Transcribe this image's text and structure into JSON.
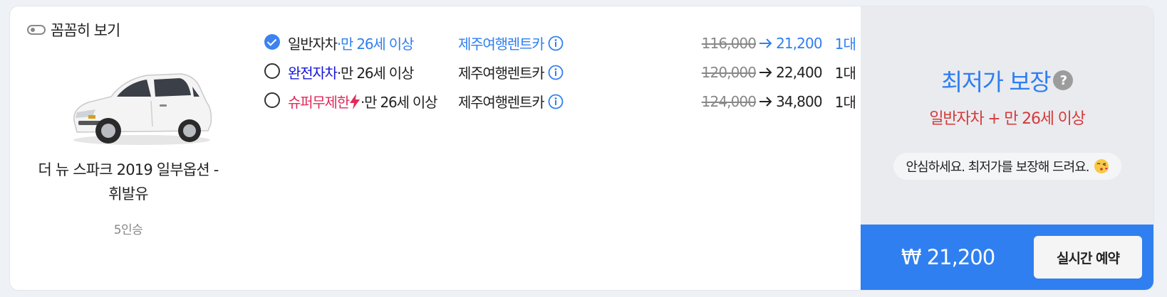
{
  "toggle": {
    "label": "꼼꼼히 보기"
  },
  "car": {
    "name": "더 뉴 스파크 2019 일부옵션 - 휘발유",
    "seats": "5인승",
    "image_icon": "car-image"
  },
  "options": [
    {
      "selected": true,
      "type": "일반자차",
      "separator": "·",
      "age": "만 26세 이상",
      "company": "제주여행렌트카",
      "old_price": "116,000",
      "new_price": "21,200",
      "qty": "1대"
    },
    {
      "selected": false,
      "type": "완전자차",
      "separator": "·",
      "age": "만 26세 이상",
      "company": "제주여행렌트카",
      "old_price": "120,000",
      "new_price": "22,400",
      "qty": "1대"
    },
    {
      "selected": false,
      "type": "슈퍼무제한",
      "separator": "·",
      "age": "만 26세 이상",
      "company": "제주여행렌트카",
      "old_price": "124,000",
      "new_price": "34,800",
      "qty": "1대"
    }
  ],
  "guarantee": {
    "title": "최저가 보장",
    "subtitle": "일반자차 + 만 26세 이상",
    "pill_text": "안심하세요. 최저가를 보장해 드려요.",
    "pill_emoji_icon": "kissing-face-icon"
  },
  "booking": {
    "total": "₩ 21,200",
    "button_label": "실시간 예약"
  },
  "colors": {
    "accent_blue": "#2f7ff0",
    "navy": "#1515d9",
    "pink": "#e02b5a",
    "red": "#d53a39",
    "panel_gray": "#e9ebef"
  }
}
